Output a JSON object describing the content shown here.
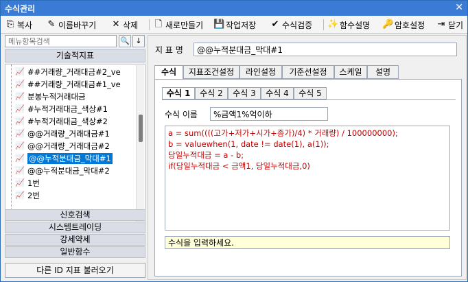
{
  "window": {
    "title": "수식관리",
    "close_glyph": "✕"
  },
  "toolbar": [
    {
      "icon": "copy-icon",
      "glyph": "⎘",
      "label": "복사"
    },
    {
      "icon": "rename-icon",
      "glyph": "✎",
      "label": "이름바꾸기"
    },
    {
      "icon": "delete-icon",
      "glyph": "✕",
      "label": "삭제"
    },
    {
      "icon": "new-icon",
      "glyph": "🗋",
      "label": "새로만들기"
    },
    {
      "icon": "save-icon",
      "glyph": "💾",
      "label": "작업저장"
    },
    {
      "icon": "check-icon",
      "glyph": "✔",
      "label": "수식검증"
    },
    {
      "icon": "wand-icon",
      "glyph": "✨",
      "label": "함수설명"
    },
    {
      "icon": "key-icon",
      "glyph": "🔑",
      "label": "암호설정"
    },
    {
      "icon": "close-door-icon",
      "glyph": "⇥",
      "label": "닫기"
    }
  ],
  "search": {
    "placeholder": "메뉴항목검색",
    "search_glyph": "🔍",
    "down_glyph": "↓"
  },
  "category": "기술적지표",
  "tree_items": [
    {
      "label": "##거래량_거래대금#2_ve"
    },
    {
      "label": "##거래량_거래대금#1_ve"
    },
    {
      "label": "분봉누적거래대금"
    },
    {
      "label": "#누적거래대금_색상#1"
    },
    {
      "label": "#누적거래대금_색상#2"
    },
    {
      "label": "@@거래량_거래대금#1"
    },
    {
      "label": "@@거래량_거래대금#2"
    },
    {
      "label": "@@누적분대금_막대#1",
      "selected": true
    },
    {
      "label": "@@누적분대금_막대#2"
    },
    {
      "label": "1번"
    },
    {
      "label": "2번"
    }
  ],
  "sections": [
    "신호검색",
    "시스템트레이딩",
    "강세약세",
    "일반함수"
  ],
  "load_button": "다른 ID 지표 불러오기",
  "formula": {
    "name_label": "지 표 명",
    "name_value": "@@누적분대금_막대#1"
  },
  "main_tabs": [
    "수식",
    "지표조건설정",
    "라인설정",
    "기준선설정",
    "스케일",
    "설명"
  ],
  "sub_tabs": [
    "수식 1",
    "수식 2",
    "수식 3",
    "수식 4",
    "수식 5"
  ],
  "sub": {
    "name_label": "수식 이름",
    "name_value": "%금액1%억이하"
  },
  "code": [
    "a = sum((((고가+저가+시가+종가)/4) * 거래량) / 100000000);",
    "b = valuewhen(1, date != date(1), a(1));",
    "당일누적대금 = a - b;",
    "if(당일누적대금 < 금액1, 당일누적대금,0)"
  ],
  "hint": "수식을 입력하세요.",
  "colors": {
    "titlebar": "#3a7bd5",
    "selected": "#0078d7",
    "code": "#c00000",
    "hint_bg": "#ffffd8"
  }
}
